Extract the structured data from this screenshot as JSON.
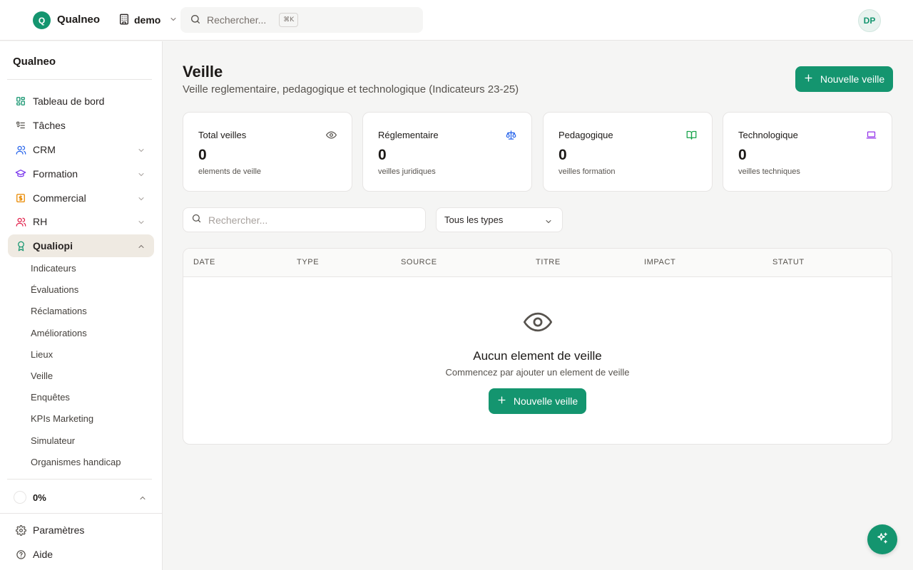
{
  "app": {
    "logo_letter": "Q",
    "name": "Qualneo"
  },
  "header": {
    "workspace": "demo",
    "search_placeholder": "Rechercher...",
    "shortcut": "⌘K",
    "avatar_initials": "DP"
  },
  "sidebar": {
    "title": "Qualneo",
    "items": [
      {
        "label": "Tableau de bord",
        "icon": "dashboard-icon"
      },
      {
        "label": "Tâches",
        "icon": "tasks-icon"
      },
      {
        "label": "CRM",
        "icon": "users-icon"
      },
      {
        "label": "Formation",
        "icon": "graduation-cap-icon"
      },
      {
        "label": "Commercial",
        "icon": "dollar-icon"
      },
      {
        "label": "RH",
        "icon": "user-group-icon"
      },
      {
        "label": "Qualiopi",
        "icon": "award-icon"
      }
    ],
    "qualiopi_sub": [
      "Indicateurs",
      "Évaluations",
      "Réclamations",
      "Améliorations",
      "Lieux",
      "Veille",
      "Enquêtes",
      "KPIs Marketing",
      "Simulateur",
      "Organismes handicap"
    ],
    "progress": "0%",
    "footer": [
      {
        "label": "Paramètres",
        "icon": "settings-icon"
      },
      {
        "label": "Aide",
        "icon": "help-icon"
      }
    ]
  },
  "page": {
    "title": "Veille",
    "subtitle": "Veille reglementaire, pedagogique et technologique (Indicateurs 23-25)",
    "new_button": "Nouvelle veille"
  },
  "stats": [
    {
      "label": "Total veilles",
      "value": "0",
      "note": "elements de veille",
      "icon": "eye-icon",
      "color": "#57534e"
    },
    {
      "label": "Réglementaire",
      "value": "0",
      "note": "veilles juridiques",
      "icon": "scale-icon",
      "color": "#2563eb"
    },
    {
      "label": "Pedagogique",
      "value": "0",
      "note": "veilles formation",
      "icon": "book-open-icon",
      "color": "#16a34a"
    },
    {
      "label": "Technologique",
      "value": "0",
      "note": "veilles techniques",
      "icon": "laptop-icon",
      "color": "#9333ea"
    }
  ],
  "filters": {
    "search_placeholder": "Rechercher...",
    "type_select": "Tous les types"
  },
  "table": {
    "columns": [
      "DATE",
      "TYPE",
      "SOURCE",
      "TITRE",
      "IMPACT",
      "STATUT"
    ],
    "empty_title": "Aucun element de veille",
    "empty_subtitle": "Commencez par ajouter un element de veille",
    "empty_button": "Nouvelle veille"
  },
  "colors": {
    "accent": "#14956f",
    "active_bg": "#efeae2"
  }
}
